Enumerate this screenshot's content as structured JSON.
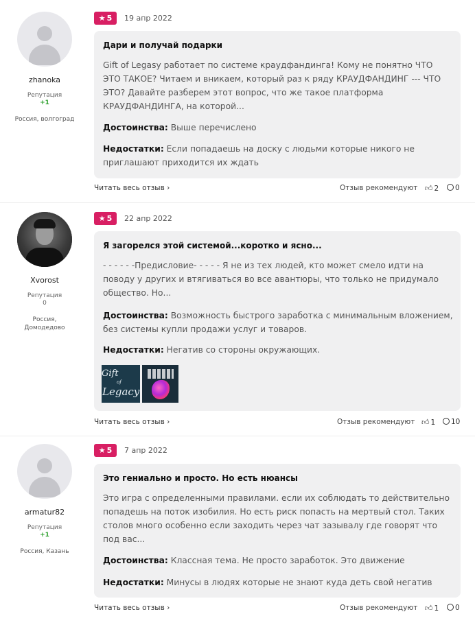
{
  "reviews": [
    {
      "user": {
        "name": "zhanoka",
        "rep_label": "Репутация",
        "rep_value": "+1",
        "location": "Россия, волгоград"
      },
      "rating": "5",
      "date": "19 апр 2022",
      "title": "Дари и получай подарки",
      "body": "Gift of Legasy работает по системе краудфандинга! Кому не понятно ЧТО ЭТО ТАКОЕ? Читаем и вникаем, который раз к ряду КРАУДФАНДИНГ --- ЧТО ЭТО? Давайте разберем этот вопрос, что же такое платформа КРАУДФАНДИНГА, на которой...",
      "pros_label": "Достоинства:",
      "pros": "Выше перечислено",
      "cons_label": "Недостатки:",
      "cons": "Если попадаешь на доску с людьми которые никого не приглашают приходится их ждать",
      "read_more": "Читать весь отзыв",
      "recommends": "Отзыв рекомендуют",
      "likes": "2",
      "comments": "0"
    },
    {
      "user": {
        "name": "Xvorost",
        "rep_label": "Репутация",
        "rep_value": "0",
        "location": "Россия, Домодедово"
      },
      "rating": "5",
      "date": "22 апр 2022",
      "title": "Я загорелся этой системой...коротко и ясно...",
      "body": "- - - - - -Предисловие- - - - - Я не из тех людей, кто может смело идти на поводу у других и втягиваться во все авантюры, что только не придумало общество. Но...",
      "pros_label": "Достоинства:",
      "pros": "Возможность быстрого заработка с минимальным вложением, без системы купли продажи услуг и товаров.",
      "cons_label": "Недостатки:",
      "cons": "Негатив со стороны окружающих.",
      "image_text": [
        "Gift",
        "of",
        "Legacy"
      ],
      "read_more": "Читать весь отзыв",
      "recommends": "Отзыв рекомендуют",
      "likes": "1",
      "comments": "10"
    },
    {
      "user": {
        "name": "armatur82",
        "rep_label": "Репутация",
        "rep_value": "+1",
        "location": "Россия, Казань"
      },
      "rating": "5",
      "date": "7 апр 2022",
      "title": "Это гениально и просто. Но есть нюансы",
      "body": "Это игра с определенными правилами. если их соблюдать то действительно попадешь на поток изобилия. Но есть риск попасть на мертвый стол. Таких столов много особенно если заходить через чат зазывалу где говорят что под вас...",
      "pros_label": "Достоинства:",
      "pros": "Классная тема. Не просто заработок. Это движение",
      "cons_label": "Недостатки:",
      "cons": "Минусы в людях которые не знают куда деть свой негатив",
      "read_more": "Читать весь отзыв",
      "recommends": "Отзыв рекомендуют",
      "likes": "1",
      "comments": "0"
    }
  ],
  "colors": {
    "badge": "#d81f63",
    "card_bg": "#f0f0f1",
    "positive": "#2ea12e"
  },
  "icons": {
    "rating": "star-icon",
    "read_more": "chevron-right-icon",
    "like": "thumbs-up-icon",
    "comment": "comment-bubble-icon"
  }
}
